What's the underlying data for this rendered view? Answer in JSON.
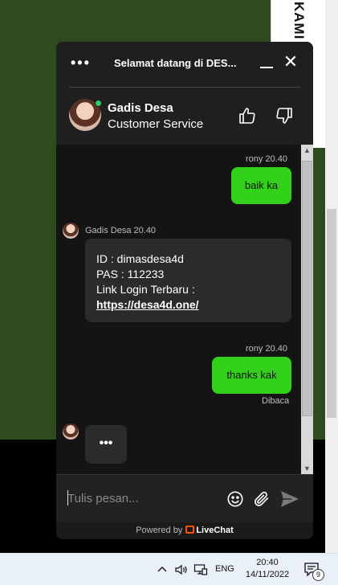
{
  "background": {
    "side_text": "KAMI"
  },
  "header": {
    "menu_icon": "more-dots-icon",
    "title": "Selamat datang di DES...",
    "agent_name": "Gadis Desa",
    "agent_role": "Customer Service"
  },
  "messages": [
    {
      "sender": "rony",
      "time": "rony 20.40",
      "text": "baik ka"
    },
    {
      "sender": "agent",
      "time": "Gadis Desa 20.40",
      "lines": [
        "ID : dimasdesa4d",
        "PAS : 112233",
        "Link Login Terbaru :"
      ],
      "link": "https://desa4d.one/"
    },
    {
      "sender": "rony",
      "time": "rony 20.40",
      "text": "thanks kak",
      "status": "Dibaca"
    }
  ],
  "typing_indicator": "•••",
  "composer": {
    "placeholder": "Tulis pesan..."
  },
  "footer": {
    "powered_by": "Powered by",
    "brand": "LiveChat"
  },
  "taskbar": {
    "language": "ENG",
    "time": "20:40",
    "date": "14/11/2022",
    "notification_count": "9"
  },
  "colors": {
    "accent_green": "#33d11b",
    "online": "#30c86b",
    "livechat_orange": "#ff5100"
  }
}
